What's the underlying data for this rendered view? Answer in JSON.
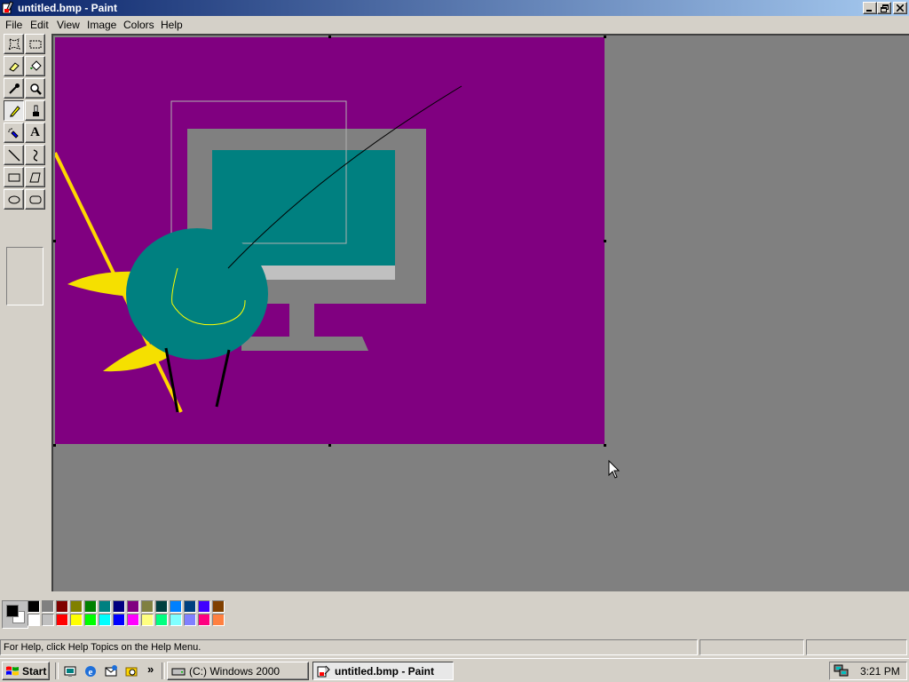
{
  "window": {
    "title": "untitled.bmp - Paint",
    "controls": {
      "minimize": "_",
      "maximize": "□",
      "close": "×"
    }
  },
  "menu": [
    "File",
    "Edit",
    "View",
    "Image",
    "Colors",
    "Help"
  ],
  "toolbox": {
    "tools": [
      {
        "name": "free-form-select",
        "icon": "free-select-icon"
      },
      {
        "name": "select",
        "icon": "rect-select-icon"
      },
      {
        "name": "eraser",
        "icon": "eraser-icon"
      },
      {
        "name": "fill",
        "icon": "fill-bucket-icon"
      },
      {
        "name": "pick-color",
        "icon": "eyedropper-icon"
      },
      {
        "name": "magnifier",
        "icon": "magnifier-icon"
      },
      {
        "name": "pencil",
        "icon": "pencil-icon",
        "active": true
      },
      {
        "name": "brush",
        "icon": "brush-icon"
      },
      {
        "name": "airbrush",
        "icon": "airbrush-icon"
      },
      {
        "name": "text",
        "icon": "text-icon",
        "glyph": "A"
      },
      {
        "name": "line",
        "icon": "line-icon"
      },
      {
        "name": "curve",
        "icon": "curve-icon"
      },
      {
        "name": "rectangle",
        "icon": "rectangle-icon"
      },
      {
        "name": "polygon",
        "icon": "polygon-icon"
      },
      {
        "name": "ellipse",
        "icon": "ellipse-icon"
      },
      {
        "name": "rounded-rectangle",
        "icon": "rounded-rect-icon"
      }
    ]
  },
  "colors": {
    "foreground": "#000000",
    "background": "#ffffff",
    "canvas_bg": "#800080",
    "palette_top": [
      "#000000",
      "#808080",
      "#800000",
      "#808000",
      "#008000",
      "#008080",
      "#000080",
      "#800080",
      "#808040",
      "#004040",
      "#0080ff",
      "#004080",
      "#4000ff",
      "#804000"
    ],
    "palette_bottom": [
      "#ffffff",
      "#c0c0c0",
      "#ff0000",
      "#ffff00",
      "#00ff00",
      "#00ffff",
      "#0000ff",
      "#ff00ff",
      "#ffff80",
      "#00ff80",
      "#80ffff",
      "#8080ff",
      "#ff0080",
      "#ff8040"
    ]
  },
  "status": {
    "help_text": "For Help, click Help Topics on the Help Menu."
  },
  "taskbar": {
    "start_label": "Start",
    "quick_launch": [
      "show-desktop-icon",
      "internet-explorer-icon",
      "outlook-express-icon",
      "windows-explorer-icon"
    ],
    "chevron": "»",
    "tasks": [
      {
        "label": "(C:) Windows 2000",
        "icon": "drive-icon",
        "active": false
      },
      {
        "label": "untitled.bmp - Paint",
        "icon": "paint-icon",
        "active": true
      }
    ],
    "clock": "3:21 PM",
    "tray_icon": "network-icon"
  }
}
